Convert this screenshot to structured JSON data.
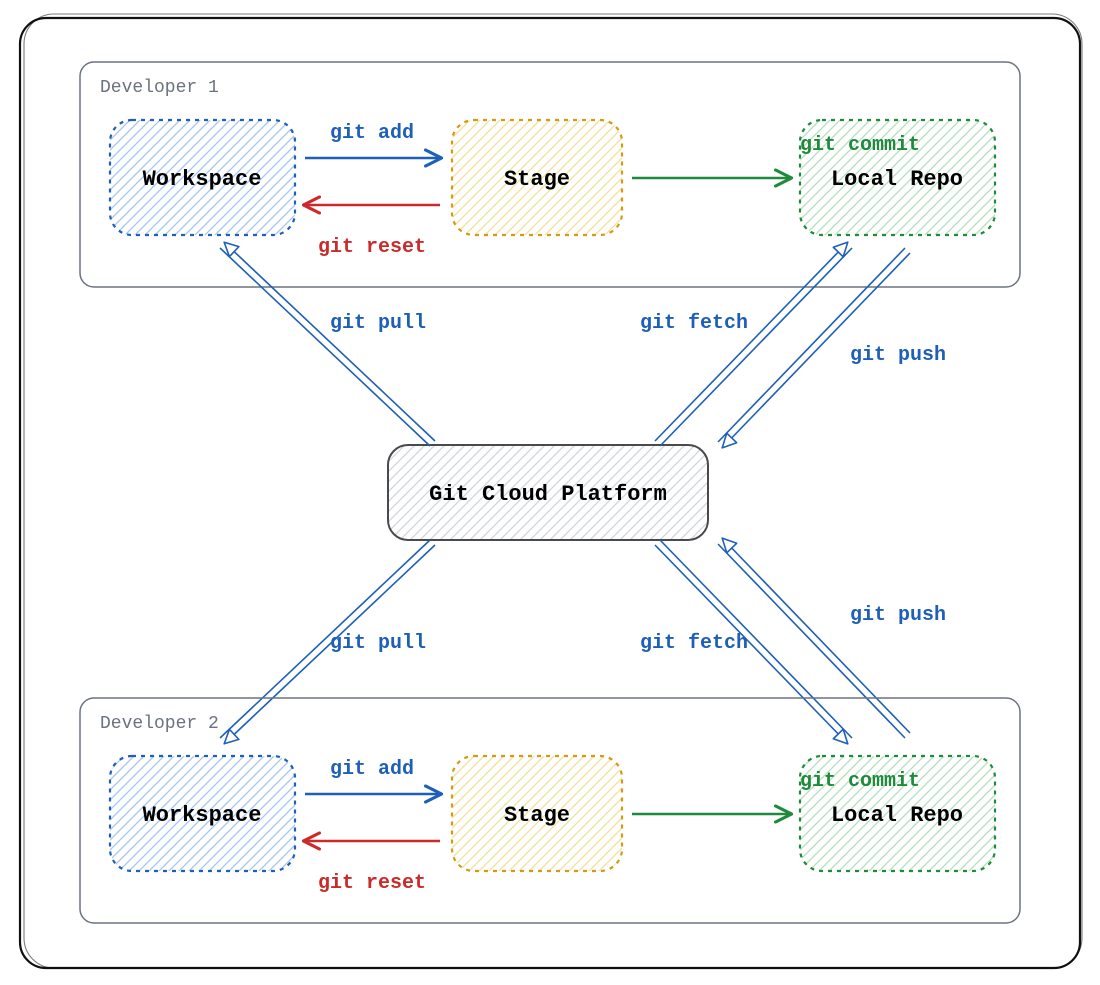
{
  "colors": {
    "outer": "#111111",
    "group": "#6b7280",
    "blue": "#1e5fb8",
    "blueHatch": "#a3c6f0",
    "yellow": "#d49a13",
    "yellowHatch": "#f2e09a",
    "green": "#1f8a3b",
    "greenHatch": "#b3e0bd",
    "gray": "#4a4a4a",
    "grayHatch": "#d0d6dc",
    "red": "#cc2a2a"
  },
  "groups": {
    "dev1": "Developer 1",
    "dev2": "Developer 2"
  },
  "nodes": {
    "workspace": "Workspace",
    "stage": "Stage",
    "localrepo": "Local Repo",
    "cloud": "Git Cloud Platform"
  },
  "commands": {
    "add": "git add",
    "reset": "git reset",
    "commit": "git commit",
    "pull": "git pull",
    "fetch": "git fetch",
    "push": "git push"
  }
}
